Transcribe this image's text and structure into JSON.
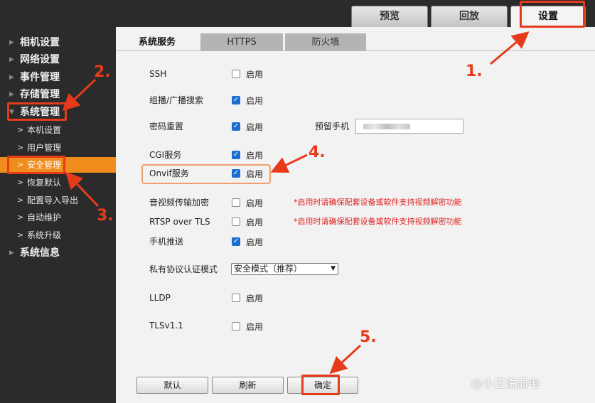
{
  "top_tabs": [
    {
      "label": "预览"
    },
    {
      "label": "回放"
    },
    {
      "label": "设置"
    }
  ],
  "sidebar": {
    "items": [
      {
        "label": "相机设置"
      },
      {
        "label": "网络设置"
      },
      {
        "label": "事件管理"
      },
      {
        "label": "存储管理"
      },
      {
        "label": "系统管理"
      },
      {
        "label": "系统信息"
      }
    ],
    "sub_items": [
      {
        "label": "本机设置"
      },
      {
        "label": "用户管理"
      },
      {
        "label": "安全管理"
      },
      {
        "label": "恢复默认"
      },
      {
        "label": "配置导入导出"
      },
      {
        "label": "自动维护"
      },
      {
        "label": "系统升级"
      }
    ]
  },
  "content_tabs": [
    {
      "label": "系统服务"
    },
    {
      "label": "HTTPS"
    },
    {
      "label": "防火墙"
    }
  ],
  "enable_label": "启用",
  "rows": [
    {
      "label": "SSH",
      "checked": false
    },
    {
      "label": "组播/广播搜索",
      "checked": true
    },
    {
      "label": "密码重置",
      "checked": true
    },
    {
      "label": "CGI服务",
      "checked": true
    },
    {
      "label": "Onvif服务",
      "checked": true
    },
    {
      "label": "音视频传输加密",
      "checked": false
    },
    {
      "label": "RTSP over TLS",
      "checked": false
    },
    {
      "label": "手机推送",
      "checked": true
    },
    {
      "label": "LLDP",
      "checked": false
    },
    {
      "label": "TLSv1.1",
      "checked": false
    }
  ],
  "reserved_phone_label": "预留手机",
  "warning_text": "*启用时请确保配套设备或软件支持视频解密功能",
  "private_protocol": {
    "label": "私有协议认证模式",
    "value": "安全模式（推荐）"
  },
  "buttons": {
    "default": "默认",
    "refresh": "刷新",
    "confirm": "确定"
  },
  "annotations": [
    "1.",
    "2.",
    "3.",
    "4.",
    "5."
  ],
  "watermark": "@小王说弱电",
  "colors": {
    "accent_orange": "#f08c1c",
    "annotation_red": "#e63b1b",
    "checkbox_blue": "#1a6fd0",
    "warning_red": "#e02020"
  }
}
